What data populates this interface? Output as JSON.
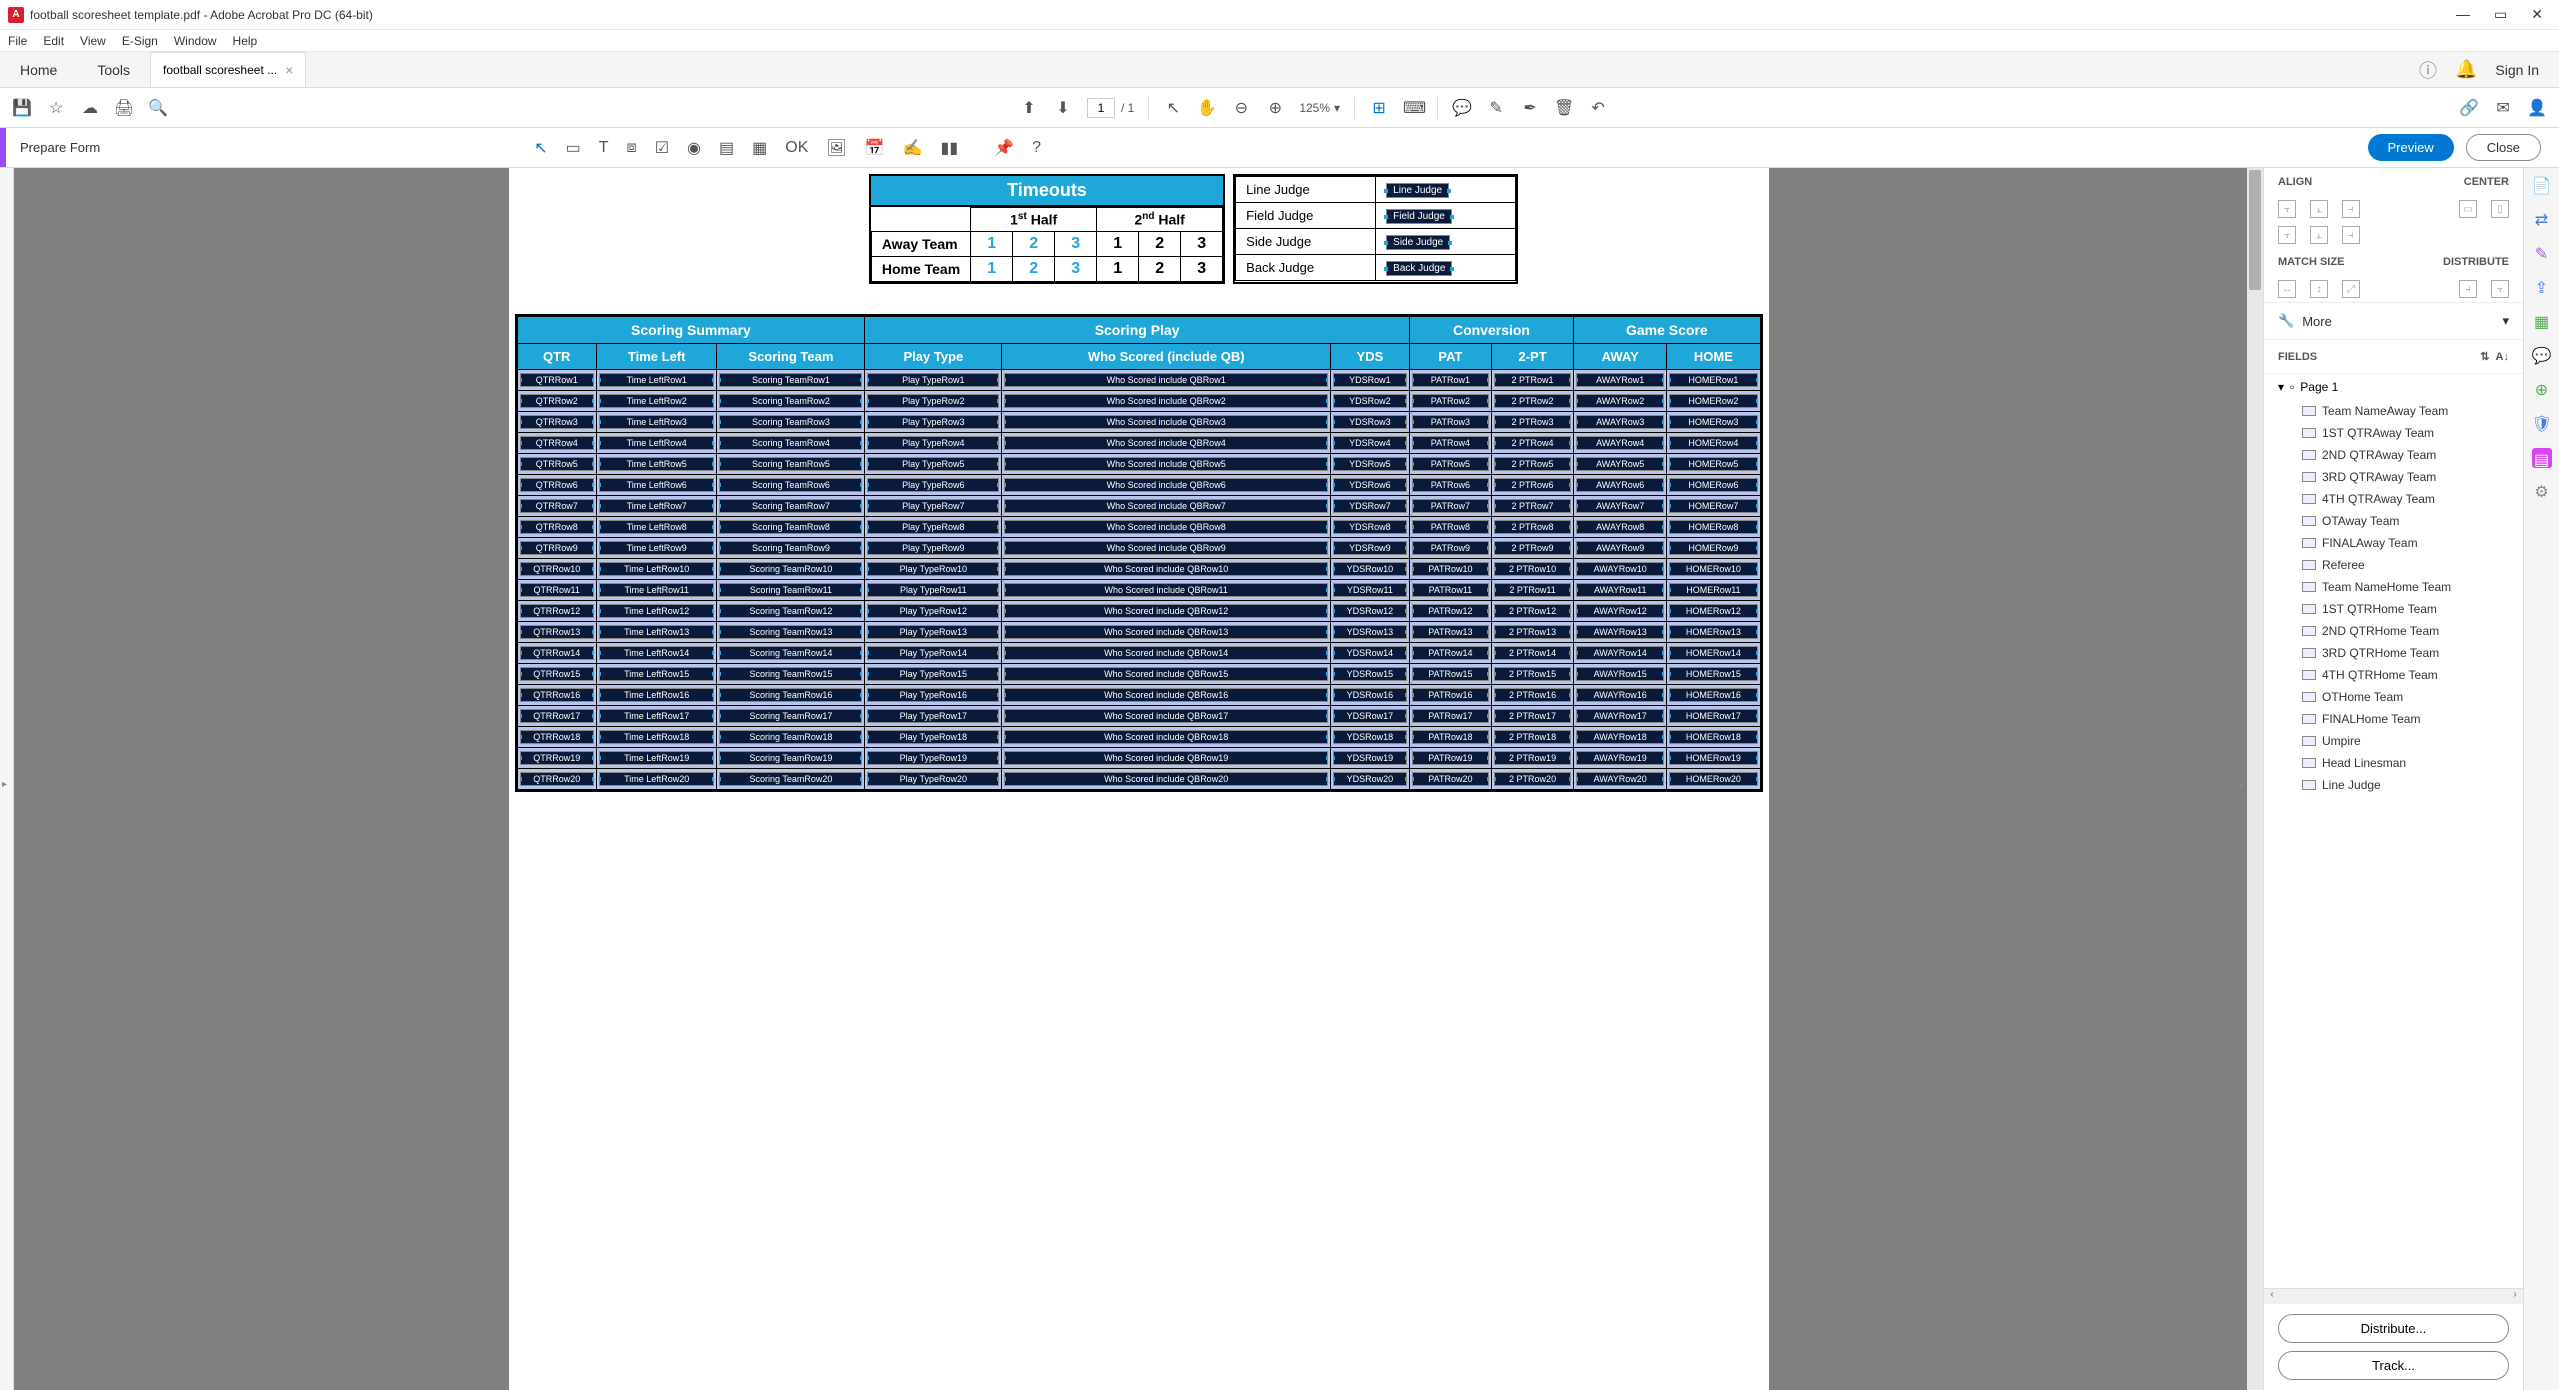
{
  "title": "football scoresheet template.pdf - Adobe Acrobat Pro DC (64-bit)",
  "menus": [
    "File",
    "Edit",
    "View",
    "E-Sign",
    "Window",
    "Help"
  ],
  "tabs": {
    "home": "Home",
    "tools": "Tools",
    "doc": "football scoresheet ..."
  },
  "signin": "Sign In",
  "toolbar": {
    "page_cur": "1",
    "page_total": "/ 1",
    "zoom": "125%"
  },
  "prepbar": {
    "label": "Prepare Form",
    "preview": "Preview",
    "close": "Close"
  },
  "timeouts": {
    "title": "Timeouts",
    "half1": "1",
    "half1_sup": "st",
    "half1_rest": " Half",
    "half2": "2",
    "half2_sup": "nd",
    "half2_rest": " Half",
    "away": "Away Team",
    "home": "Home Team",
    "away_nums": [
      "1",
      "2",
      "3",
      "1",
      "2",
      "3"
    ],
    "home_nums": [
      "1",
      "2",
      "3",
      "1",
      "2",
      "3"
    ]
  },
  "officials": [
    {
      "role": "Line Judge",
      "field": "Line Judge"
    },
    {
      "role": "Field Judge",
      "field": "Field Judge"
    },
    {
      "role": "Side Judge",
      "field": "Side Judge"
    },
    {
      "role": "Back Judge",
      "field": "Back Judge"
    }
  ],
  "scoring_headers": {
    "summary": "Scoring Summary",
    "play": "Scoring Play",
    "conv": "Conversion",
    "score": "Game Score",
    "qtr": "QTR",
    "tl": "Time Left",
    "st": "Scoring Team",
    "pt": "Play Type",
    "ws": "Who Scored (include QB)",
    "yds": "YDS",
    "pat": "PAT",
    "pt2": "2-PT",
    "aw": "AWAY",
    "hm": "HOME"
  },
  "scoring_rows": 20,
  "row_field_labels": {
    "qtr": "QTRRow",
    "tl": "Time LeftRow",
    "st": "Scoring TeamRow",
    "pt": "Play TypeRow",
    "ws": "Who Scored include QBRow",
    "yds": "YDSRow",
    "pat": "PATRow",
    "pt2": "2 PTRow",
    "aw": "AWAYRow",
    "hm": "HOMERow"
  },
  "panel": {
    "align": "ALIGN",
    "center": "CENTER",
    "match": "MATCH SIZE",
    "dist": "DISTRIBUTE",
    "more": "More",
    "fields": "FIELDS",
    "page": "Page 1",
    "fieldlist": [
      "Team NameAway Team",
      "1ST QTRAway Team",
      "2ND QTRAway Team",
      "3RD QTRAway Team",
      "4TH QTRAway Team",
      "OTAway Team",
      "FINALAway Team",
      "Referee",
      "Team NameHome Team",
      "1ST QTRHome Team",
      "2ND QTRHome Team",
      "3RD QTRHome Team",
      "4TH QTRHome Team",
      "OTHome Team",
      "FINALHome Team",
      "Umpire",
      "Head Linesman",
      "Line Judge"
    ],
    "distribute_btn": "Distribute...",
    "track_btn": "Track..."
  }
}
